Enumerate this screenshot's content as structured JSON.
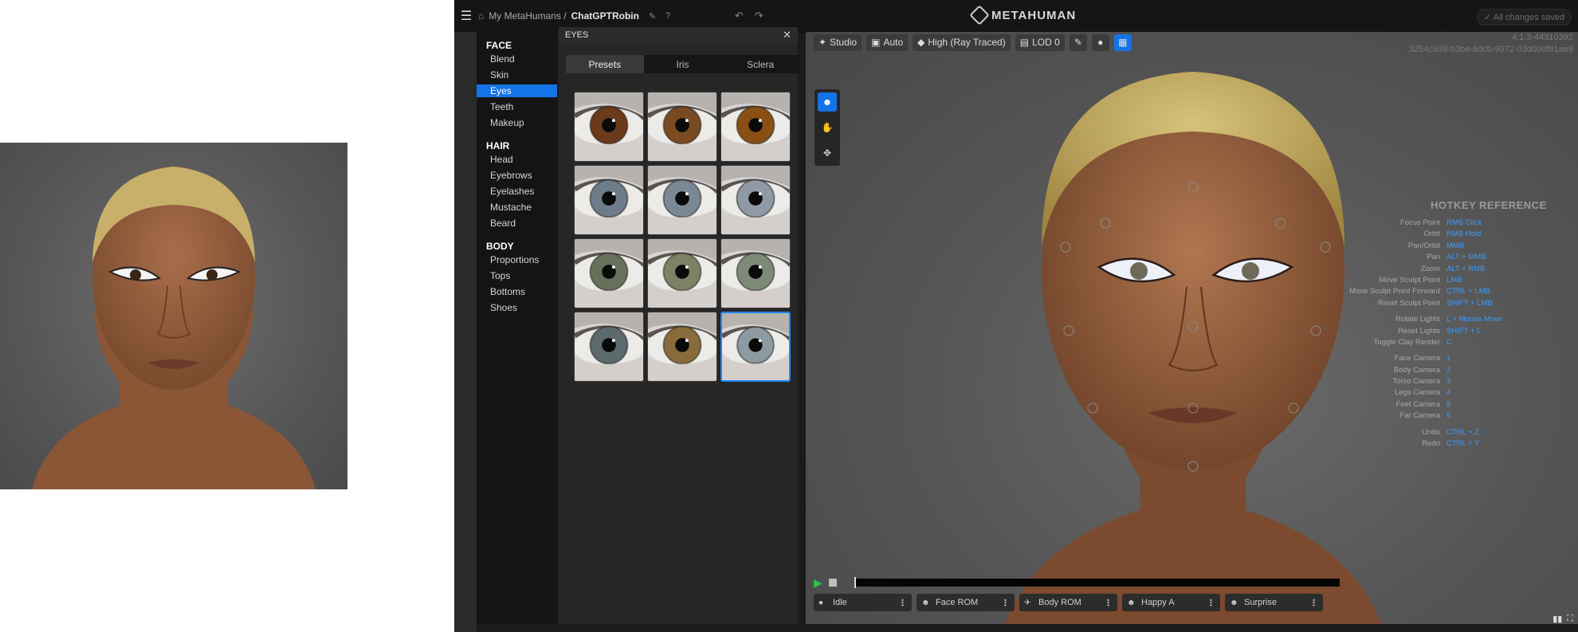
{
  "topbar": {
    "breadcrumb_root": "My MetaHumans /",
    "breadcrumb_current": "ChatGPTRobin",
    "logo_text": "METAHUMAN",
    "save_status": "All changes saved"
  },
  "categories": {
    "face_heading": "FACE",
    "face_items": [
      "Blend",
      "Skin",
      "Eyes",
      "Teeth",
      "Makeup"
    ],
    "hair_heading": "HAIR",
    "hair_items": [
      "Head",
      "Eyebrows",
      "Eyelashes",
      "Mustache",
      "Beard"
    ],
    "body_heading": "BODY",
    "body_items": [
      "Proportions",
      "Tops",
      "Bottoms",
      "Shoes"
    ],
    "active": "Eyes"
  },
  "eyes_panel": {
    "title": "EYES",
    "tabs": [
      "Presets",
      "Iris",
      "Sclera"
    ],
    "active_tab": "Presets",
    "presets": [
      {
        "iris": "#6b3a1a"
      },
      {
        "iris": "#7a4a22"
      },
      {
        "iris": "#8a4f12"
      },
      {
        "iris": "#6e7c8a"
      },
      {
        "iris": "#7a8896"
      },
      {
        "iris": "#8f9aa6"
      },
      {
        "iris": "#66705a"
      },
      {
        "iris": "#7c8266"
      },
      {
        "iris": "#7e8a78"
      },
      {
        "iris": "#5c6a6e"
      },
      {
        "iris": "#8a6c3c"
      },
      {
        "iris": "#8e9aa2"
      }
    ],
    "selected_index": 11
  },
  "viewport": {
    "toolbar": {
      "studio": "Studio",
      "auto": "Auto",
      "quality": "High (Ray Traced)",
      "lod": "LOD 0"
    },
    "version_line1": "4.1.3-44310392",
    "version_line2": "3254c939-b3be-6dcb-9972-03d00df91ae9",
    "hotkeys_title": "HOTKEY REFERENCE",
    "hotkeys": [
      {
        "label": "Focus Point",
        "key": "RMB Click"
      },
      {
        "label": "Orbit",
        "key": "RMB Hold"
      },
      {
        "label": "Pan/Orbit",
        "key": "MMB"
      },
      {
        "label": "Pan",
        "key": "ALT + MMB"
      },
      {
        "label": "Zoom",
        "key": "ALT + RMB"
      },
      {
        "label": "Move Sculpt Point",
        "key": "LMB"
      },
      {
        "label": "Move Sculpt Point Forward",
        "key": "CTRL + LMB"
      },
      {
        "label": "Reset Sculpt Point",
        "key": "SHIFT + LMB"
      },
      {
        "label": "Rotate Lights",
        "key": "L + Mouse Move"
      },
      {
        "label": "Reset Lights",
        "key": "SHIFT + L"
      },
      {
        "label": "Toggle Clay Render",
        "key": "C"
      },
      {
        "label": "Face Camera",
        "key": "1"
      },
      {
        "label": "Body Camera",
        "key": "2"
      },
      {
        "label": "Torso Camera",
        "key": "3"
      },
      {
        "label": "Legs Camera",
        "key": "4"
      },
      {
        "label": "Feet Camera",
        "key": "5"
      },
      {
        "label": "Far Camera",
        "key": "6"
      },
      {
        "label": "Undo",
        "key": "CTRL + Z"
      },
      {
        "label": "Redo",
        "key": "CTRL + Y"
      }
    ],
    "animations": [
      "Idle",
      "Face ROM",
      "Body ROM",
      "Happy A",
      "Surprise"
    ]
  },
  "colors": {
    "accent": "#1473e6",
    "hotkey": "#3a9bff",
    "play": "#27c24c"
  }
}
